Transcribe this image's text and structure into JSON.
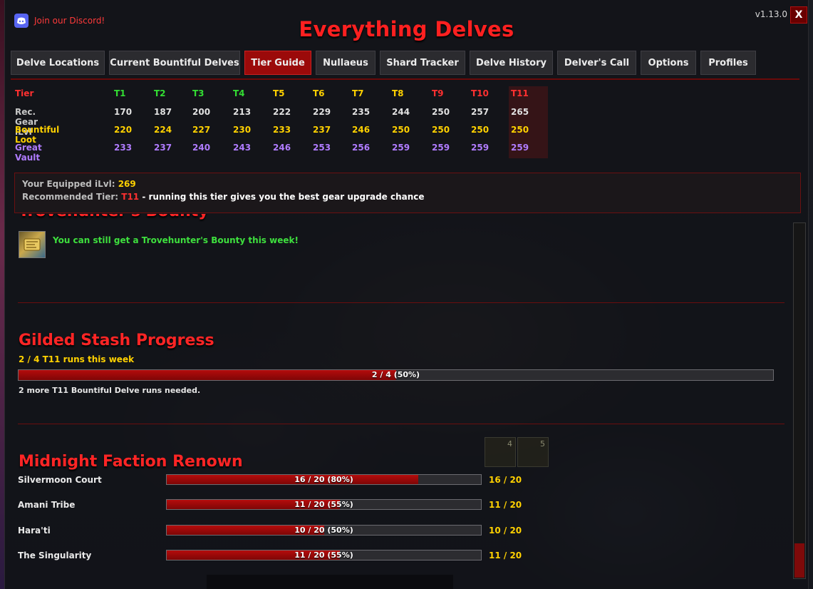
{
  "header": {
    "discord_label": "Join our Discord!",
    "title": "Everything Delves",
    "version": "v1.13.0",
    "close_label": "X"
  },
  "tabs": [
    {
      "label": "Delve Locations",
      "active": false
    },
    {
      "label": "Current Bountiful Delves",
      "active": false
    },
    {
      "label": "Tier Guide",
      "active": true
    },
    {
      "label": "Nullaeus",
      "active": false
    },
    {
      "label": "Shard Tracker",
      "active": false
    },
    {
      "label": "Delve History",
      "active": false
    },
    {
      "label": "Delver's Call",
      "active": false
    },
    {
      "label": "Options",
      "active": false
    },
    {
      "label": "Profiles",
      "active": false
    }
  ],
  "tier_table": {
    "header_label": "Tier",
    "tiers": [
      "T1",
      "T2",
      "T3",
      "T4",
      "T5",
      "T6",
      "T7",
      "T8",
      "T9",
      "T10",
      "T11"
    ],
    "tier_colors": [
      "#33dd33",
      "#33dd33",
      "#33dd33",
      "#33dd33",
      "#ffd100",
      "#ffd100",
      "#ffd100",
      "#ffd100",
      "#ff3030",
      "#ff3030",
      "#ff3030"
    ],
    "rows": [
      {
        "label": "Rec. Gear iLvl",
        "color": "#e0e0e0",
        "label_color": "#c8c8c8",
        "values": [
          "170",
          "187",
          "200",
          "213",
          "222",
          "229",
          "235",
          "244",
          "250",
          "257",
          "265"
        ]
      },
      {
        "label": "Bountiful Loot",
        "color": "#ffd100",
        "label_color": "#ffd100",
        "values": [
          "220",
          "224",
          "227",
          "230",
          "233",
          "237",
          "246",
          "250",
          "250",
          "250",
          "250"
        ]
      },
      {
        "label": "Great Vault",
        "color": "#b07cff",
        "label_color": "#b07cff",
        "values": [
          "233",
          "237",
          "240",
          "243",
          "246",
          "253",
          "256",
          "259",
          "259",
          "259",
          "259"
        ]
      }
    ]
  },
  "ilvl_info": {
    "equipped_label": "Your Equipped iLvl:",
    "equipped_value": "269",
    "recommended_label": "Recommended Tier:",
    "recommended_tier": "T11",
    "recommended_text": "- running this tier gives you the best gear upgrade chance"
  },
  "trovehunter": {
    "heading": "Trovehunter's Bounty",
    "message": "You can still get a Trovehunter's Bounty this week!",
    "icon": "treasure-map-icon"
  },
  "gilded": {
    "heading": "Gilded Stash Progress",
    "subtitle": "2 / 4 T11 runs this week",
    "bar_text": "2 / 4  (50%)",
    "progress": 0.5,
    "note": "2 more T11 Bountiful Delve runs needed."
  },
  "renown": {
    "heading": "Midnight Faction Renown",
    "slot_numbers": [
      "4",
      "5"
    ],
    "factions": [
      {
        "name": "Silvermoon Court",
        "bar_text": "16 / 20  (80%)",
        "progress": 0.8,
        "value": "16 / 20"
      },
      {
        "name": "Amani Tribe",
        "bar_text": "11 / 20  (55%)",
        "progress": 0.55,
        "value": "11 / 20"
      },
      {
        "name": "Hara'ti",
        "bar_text": "10 / 20  (50%)",
        "progress": 0.5,
        "value": "10 / 20"
      },
      {
        "name": "The Singularity",
        "bar_text": "11 / 20  (55%)",
        "progress": 0.55,
        "value": "11 / 20"
      }
    ]
  },
  "colors": {
    "accent_red": "#ff2020",
    "active_tab": "#9b0a0a",
    "gold": "#ffd100",
    "green": "#3ee03e",
    "purple": "#b07cff"
  }
}
